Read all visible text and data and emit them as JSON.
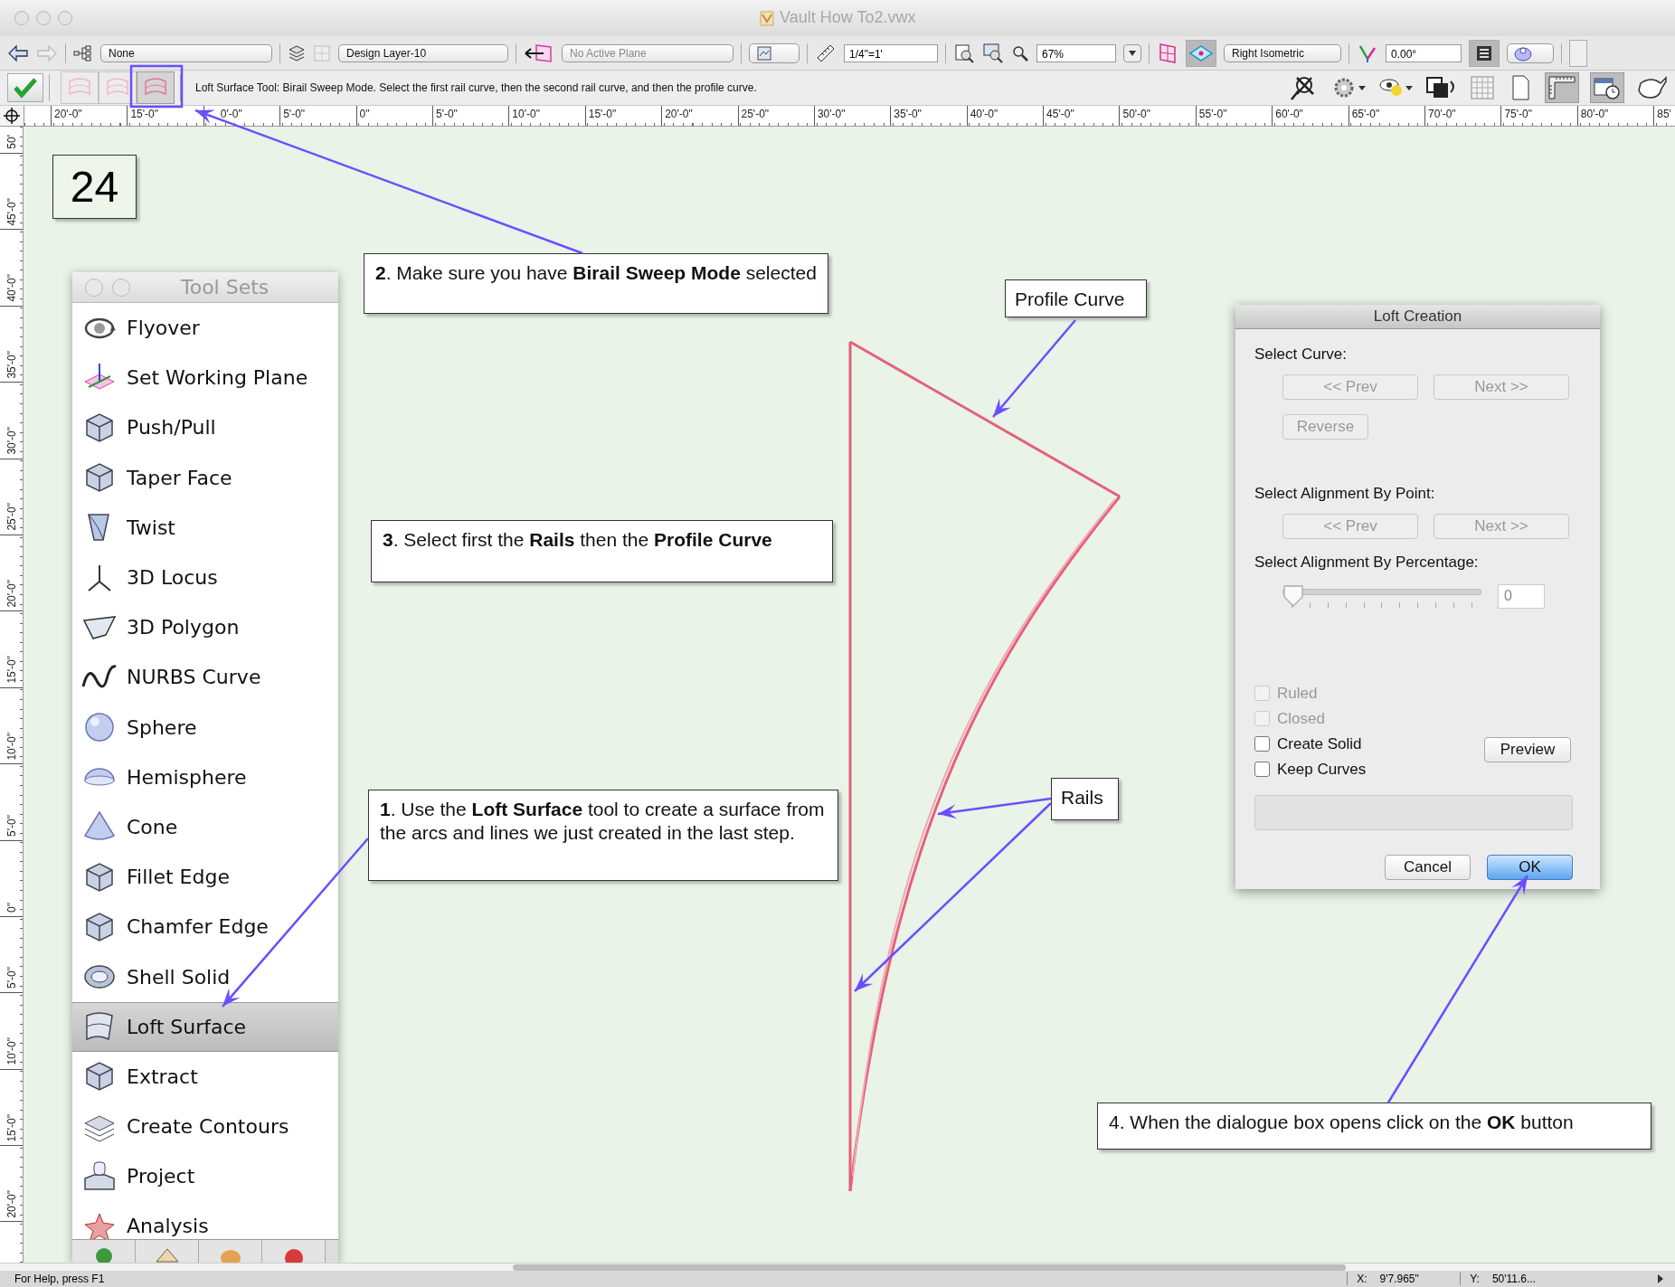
{
  "window": {
    "title": "Vault How To2.vwx"
  },
  "view_bar": {
    "class_menu": "None",
    "layer_menu": "Design Layer-10",
    "plane_menu": "No Active Plane",
    "scale": "1/4\"=1'",
    "zoom": "67%",
    "view_menu": "Right Isometric",
    "rotation": "0.00°"
  },
  "mode_bar": {
    "modes": [
      {
        "selected": false
      },
      {
        "selected": false
      },
      {
        "selected": true
      }
    ],
    "message": "Loft Surface Tool: Birail Sweep Mode. Select the first rail curve, then the second rail curve, and then the profile curve."
  },
  "rulers": {
    "horizontal": [
      "20'-0\"",
      "15'-0\"",
      "0'-0\"",
      "5'-0\"",
      "0\"",
      "5'-0\"",
      "10'-0\"",
      "15'-0\"",
      "20'-0\"",
      "25'-0\"",
      "30'-0\"",
      "35'-0\"",
      "40'-0\"",
      "45'-0\"",
      "50'-0\"",
      "55'-0\"",
      "60'-0\"",
      "65'-0\"",
      "70'-0\"",
      "75'-0\"",
      "80'-0\"",
      "85'"
    ],
    "vertical": [
      "50'",
      "45'-0\"",
      "40'-0\"",
      "35'-0\"",
      "30'-0\"",
      "25'-0\"",
      "20'-0\"",
      "15'-0\"",
      "10'-0\"",
      "5'-0\"",
      "0\"",
      "5'-0\"",
      "10'-0\"",
      "15'-0\"",
      "20'-0\""
    ]
  },
  "step_number": "24",
  "tool_palette": {
    "title": "Tool Sets",
    "tools": [
      {
        "label": "Flyover",
        "selected": false
      },
      {
        "label": "Set Working Plane",
        "selected": false
      },
      {
        "label": "Push/Pull",
        "selected": false
      },
      {
        "label": "Taper Face",
        "selected": false
      },
      {
        "label": "Twist",
        "selected": false
      },
      {
        "label": "3D Locus",
        "selected": false
      },
      {
        "label": "3D Polygon",
        "selected": false
      },
      {
        "label": "NURBS Curve",
        "selected": false
      },
      {
        "label": "Sphere",
        "selected": false
      },
      {
        "label": "Hemisphere",
        "selected": false
      },
      {
        "label": "Cone",
        "selected": false
      },
      {
        "label": "Fillet Edge",
        "selected": false
      },
      {
        "label": "Chamfer Edge",
        "selected": false
      },
      {
        "label": "Shell Solid",
        "selected": false
      },
      {
        "label": "Loft Surface",
        "selected": true
      },
      {
        "label": "Extract",
        "selected": false
      },
      {
        "label": "Create Contours",
        "selected": false
      },
      {
        "label": "Project",
        "selected": false
      },
      {
        "label": "Analysis",
        "selected": false
      }
    ]
  },
  "callouts": [
    {
      "text": "**2**. Make sure you have **Birail Sweep Mode** selected"
    },
    {
      "text": "**3**. Select first the **Rails** then the **Profile Curve**"
    },
    {
      "text": "**1**. Use the **Loft Surface** tool to create a surface from the arcs and lines we just created in the last step."
    },
    {
      "text": "4. When the dialogue box opens click on the **OK** button"
    }
  ],
  "labels": [
    {
      "text": "Profile Curve"
    },
    {
      "text": "Rails"
    }
  ],
  "loft_dialog": {
    "title": "Loft Creation",
    "select_curve": {
      "label": "Select Curve:",
      "buttons": [
        {
          "label": "<< Prev",
          "disabled": true
        },
        {
          "label": "Next >>",
          "disabled": true
        },
        {
          "label": "Reverse",
          "disabled": true
        }
      ]
    },
    "select_point": {
      "label": "Select Alignment By Point:",
      "buttons": [
        {
          "label": "<< Prev",
          "disabled": true
        },
        {
          "label": "Next >>",
          "disabled": true
        }
      ]
    },
    "select_percentage": {
      "label": "Select Alignment By Percentage:",
      "level": 0,
      "value": "0"
    },
    "checkboxes": [
      {
        "label": "Ruled",
        "checked": false,
        "disabled": true
      },
      {
        "label": "Closed",
        "checked": false,
        "disabled": true
      },
      {
        "label": "Create Solid",
        "checked": false,
        "disabled": false
      },
      {
        "label": "Keep Curves",
        "checked": false,
        "disabled": false
      }
    ],
    "preview_button": "Preview",
    "cancel_button": "Cancel",
    "ok_button": "OK"
  },
  "status_bar": {
    "help": "For Help, press F1",
    "x_label": "X:",
    "x_value": "9'7.965\"",
    "y_label": "Y:",
    "y_value": "50'11.6..."
  }
}
